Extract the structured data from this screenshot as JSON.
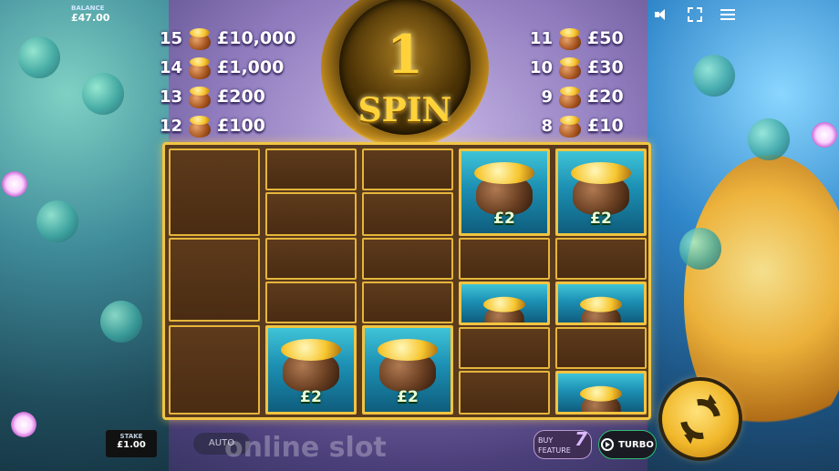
{
  "balance": {
    "label": "BALANCE",
    "value": "£47.00"
  },
  "paytable": {
    "left": [
      {
        "count": "15",
        "prize": "£10,000"
      },
      {
        "count": "14",
        "prize": "£1,000"
      },
      {
        "count": "13",
        "prize": "£200"
      },
      {
        "count": "12",
        "prize": "£100"
      }
    ],
    "right": [
      {
        "count": "11",
        "prize": "£50"
      },
      {
        "count": "10",
        "prize": "£30"
      },
      {
        "count": "9",
        "prize": "£20"
      },
      {
        "count": "8",
        "prize": "£10"
      }
    ]
  },
  "spins_remaining": {
    "number": "1",
    "word": "SPIN"
  },
  "grid": {
    "cell_value": "£2"
  },
  "controls": {
    "stake_label": "STAKE",
    "stake_value": "£1.00",
    "auto_label": "AUTO",
    "buy_label_1": "BUY",
    "buy_label_2": "FEATURE",
    "buy_seven": "7",
    "turbo_label": "TURBO"
  },
  "watermark": "online slot"
}
